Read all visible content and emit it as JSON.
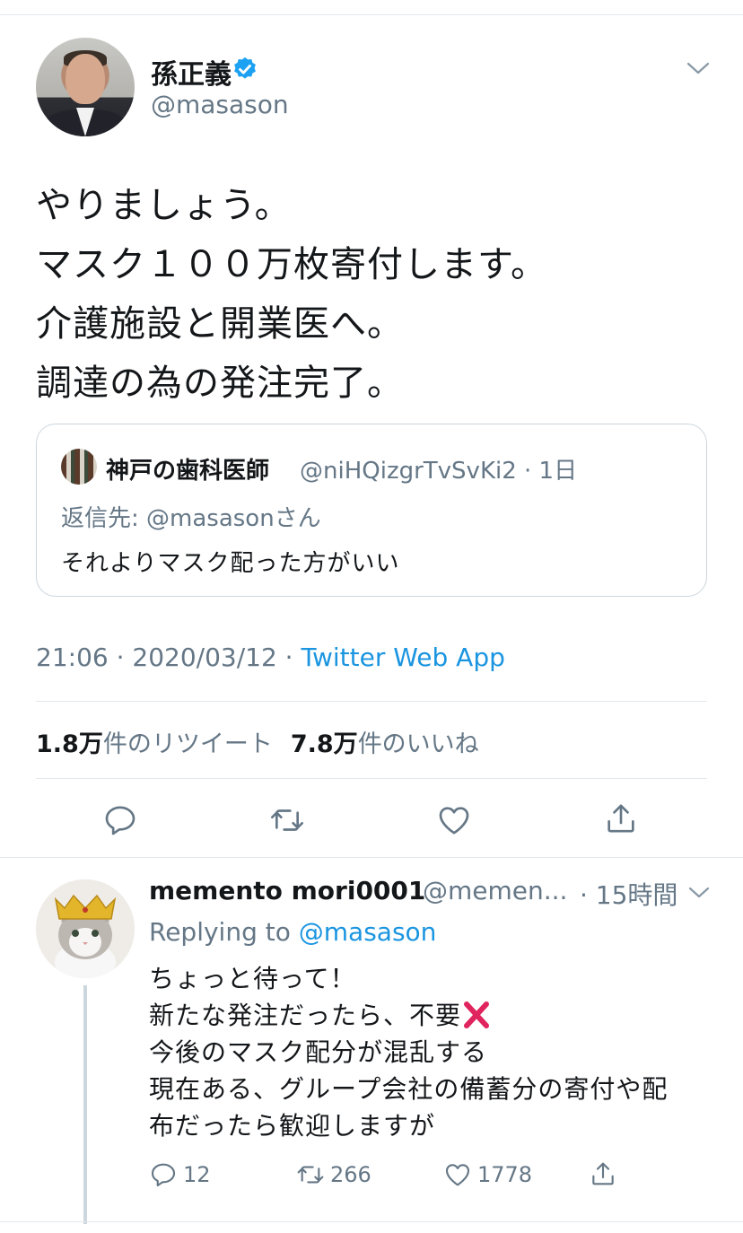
{
  "main_tweet": {
    "author_name": "孫正義",
    "author_handle": "@masason",
    "verified": true,
    "text": "やりましょう。\nマスク１００万枚寄付します。\n介護施設と開業医へ。\n調達の為の発注完了。",
    "quoted_tweet": {
      "author_name": "神戸の歯科医師",
      "author_handle_time": "@niHQizgrTvSvKi2 · 1日",
      "reply_to": "返信先: @masasonさん",
      "text": "それよりマスク配った方がいい"
    },
    "timestamp": "21:06 · 2020/03/12 · ",
    "source_app": "Twitter Web App",
    "retweet_count": "1.8万",
    "retweet_label": "件のリツイート",
    "like_count": "7.8万",
    "like_label": "件のいいね"
  },
  "reply_tweet": {
    "author_name": "memento mori0001",
    "author_handle": "@memen...",
    "time": " · 15時間",
    "replying_prefix": "Replying to ",
    "replying_handle": "@masason",
    "lines": [
      "ちょっと待って！",
      "新たな発注だったら、不要",
      "今後のマスク配分が混乱する",
      "現在ある、グループ会社の備蓄分の寄付や配",
      "布だったら歓迎しますが"
    ],
    "reply_count": "12",
    "retweet_count": "266",
    "like_count": "1778"
  },
  "colors": {
    "accent": "#1b95e0",
    "secondary_text": "#657786",
    "divider": "#e1e8ed",
    "cross_mark": "#e0245e"
  },
  "icons": [
    "verified-badge-icon",
    "chevron-down-icon",
    "reply-icon",
    "retweet-icon",
    "like-icon",
    "share-icon",
    "cross-mark-icon"
  ]
}
